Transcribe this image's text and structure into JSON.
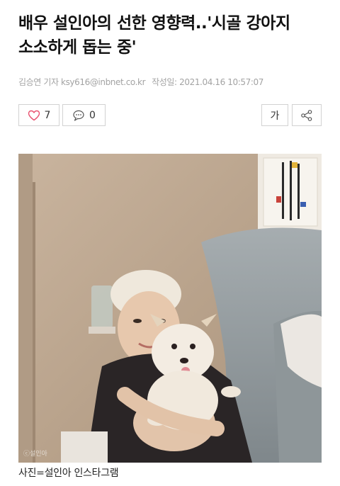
{
  "article": {
    "headline_line1": "배우 설인아의 선한 영향력..'시골 강아지",
    "headline_line2": "소소하게 돕는 중'",
    "byline_author": "김승연 기자 ksy616@inbnet.co.kr",
    "byline_date": "작성일: 2021.04.16 10:57:07"
  },
  "actions": {
    "like_count": "7",
    "comment_count": "0",
    "font_label": "가",
    "icons": [
      "heart-icon",
      "speech-bubble-icon",
      "share-icon"
    ]
  },
  "photo": {
    "credit": "ⓒ설인아",
    "caption": "사진=설인아 인스타그램"
  },
  "colors": {
    "text": "#111111",
    "meta": "#a3a3a3",
    "like_heart": "#e8506e",
    "border": "#d2d2d2"
  }
}
